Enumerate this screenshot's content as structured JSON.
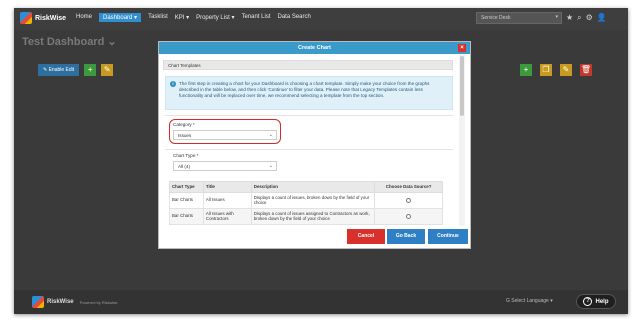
{
  "app": {
    "logo_text": "RiskWise",
    "nav": [
      "Home",
      "Dashboard",
      "Tasklist",
      "KPI",
      "Property List",
      "Tenant List",
      "Data Search"
    ],
    "nav_active_index": 1,
    "service_select": "Service Desk",
    "page_title": "Test Dashboard"
  },
  "toolbar": {
    "enable_edit_label": "Enable Edit"
  },
  "footer": {
    "logo_text": "RiskWise",
    "powered_text": "Powered by Riskwise",
    "select_language": "Select Language",
    "help_label": "Help"
  },
  "modal": {
    "title": "Create Chart",
    "close_glyph": "×",
    "section_title": "Chart Templates",
    "info_icon": "i",
    "info_text": "The first step in creating a chart for your Dashboard is choosing a chart template. Simply make your choice from the graphs described in the table below, and then click 'Continue' to filter your data. Please note that Legacy Templates contain less functionality and will be replaced over time, we recommend selecting a template from the top section.",
    "category_label": "Category *",
    "category_value": "Issues",
    "chart_type_label": "Chart Type *",
    "chart_type_value": "All (4)",
    "table": {
      "headers": [
        "Chart Type",
        "Title",
        "Description",
        "Choose Data Source?"
      ],
      "rows": [
        [
          "Bar Charts",
          "All Issues",
          "Displays a count of issues, broken down by the field of your choice",
          ""
        ],
        [
          "Bar Charts",
          "All Issues with Contractors",
          "Displays a count of issues assigned to Contractors as work, broken down by the field of your choice",
          ""
        ]
      ]
    },
    "buttons": {
      "cancel": "Cancel",
      "go_back": "Go Back",
      "continue": "Continue"
    }
  },
  "colors": {
    "header_blue": "#3a9ac9",
    "cancel_red": "#d9302c",
    "primary_blue": "#2f7fc4",
    "highlight_red": "#d42a2a"
  }
}
